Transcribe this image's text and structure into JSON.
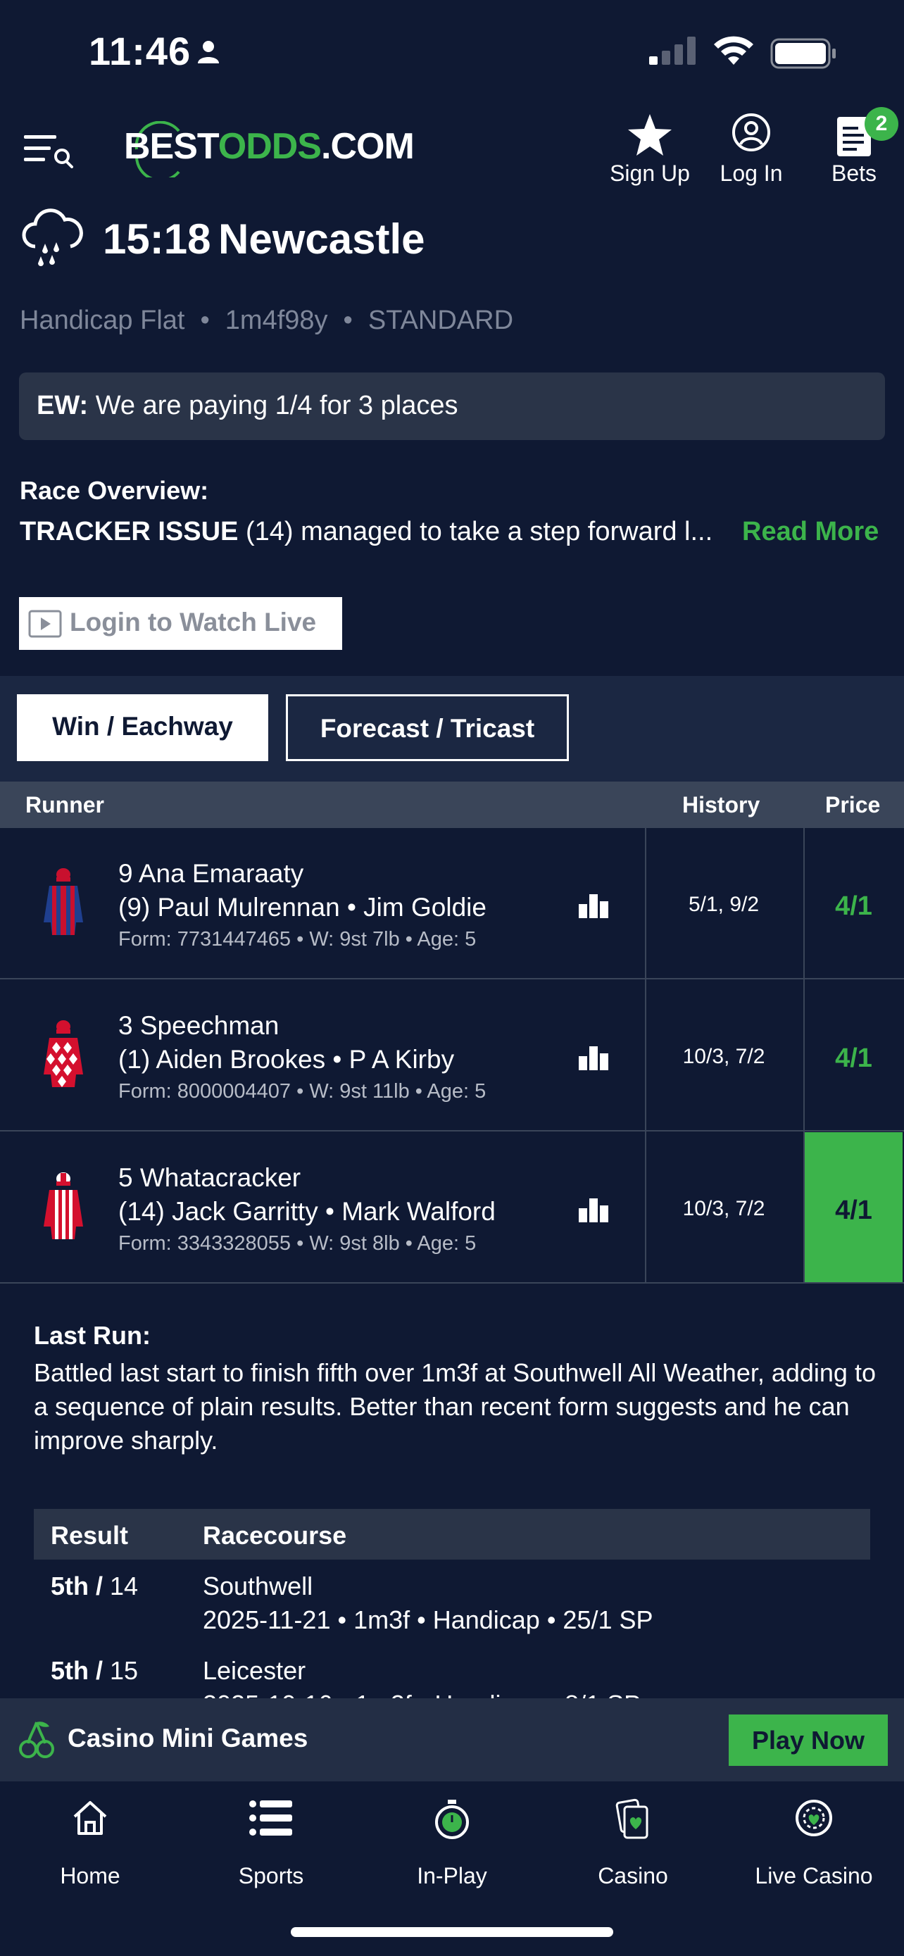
{
  "status_bar": {
    "time": "11:46"
  },
  "header": {
    "logo_best": "BEST",
    "logo_odds": "ODDS",
    "logo_com": ".COM",
    "sign_up": "Sign Up",
    "log_in": "Log In",
    "bets": "Bets",
    "bets_count": "2"
  },
  "race": {
    "time": "15:18",
    "name": "Newcastle",
    "type": "Handicap Flat",
    "distance": "1m4f98y",
    "going": "STANDARD",
    "ew_label": "EW:",
    "ew_text": "We are paying 1/4 for 3 places",
    "overview_title": "Race Overview:",
    "overview_highlight": "TRACKER ISSUE",
    "overview_text": "(14) managed to take a step forward l...",
    "read_more": "Read More",
    "watch_live": "Login to Watch Live"
  },
  "tabs": {
    "win": "Win / Eachway",
    "forecast": "Forecast / Tricast"
  },
  "table": {
    "col_runner": "Runner",
    "col_history": "History",
    "col_price": "Price",
    "runners": [
      {
        "name": "9 Ana Emaraaty",
        "jockey": "(9) Paul Mulrennan • Jim Goldie",
        "form": "Form: 7731447465 • W: 9st 7lb • Age: 5",
        "history": "5/1, 9/2",
        "price": "4/1"
      },
      {
        "name": "3 Speechman",
        "jockey": "(1) Aiden Brookes • P A Kirby",
        "form": "Form: 8000004407 • W: 9st 11lb • Age: 5",
        "history": "10/3, 7/2",
        "price": "4/1"
      },
      {
        "name": "5 Whatacracker",
        "jockey": "(14) Jack Garritty • Mark Walford",
        "form": "Form: 3343328055 • W: 9st 8lb • Age: 5",
        "history": "10/3, 7/2",
        "price": "4/1"
      }
    ]
  },
  "last_run": {
    "title": "Last Run:",
    "text": "Battled last start to finish fifth over 1m3f at Southwell All Weather, adding to a sequence of plain results. Better than recent form suggests and he can improve sharply.",
    "col_result": "Result",
    "col_racecourse": "Racecourse",
    "results": [
      {
        "place": "5th /",
        "field": " 14",
        "course": "Southwell",
        "detail": "2025-11-21  •  1m3f  •  Handicap  •  25/1 SP"
      },
      {
        "place": "5th /",
        "field": " 15",
        "course": "Leicester",
        "detail": "2025-10-16  •  1m2f  •  Handicap  •  8/1 SP"
      }
    ]
  },
  "promo": {
    "label": "Casino Mini Games",
    "button": "Play Now"
  },
  "bottom_nav": {
    "home": "Home",
    "sports": "Sports",
    "inplay": "In-Play",
    "casino": "Casino",
    "live_casino": "Live Casino"
  },
  "colors": {
    "background": "#0f1933",
    "accent": "#3cb44b",
    "panel": "#2a3448"
  }
}
